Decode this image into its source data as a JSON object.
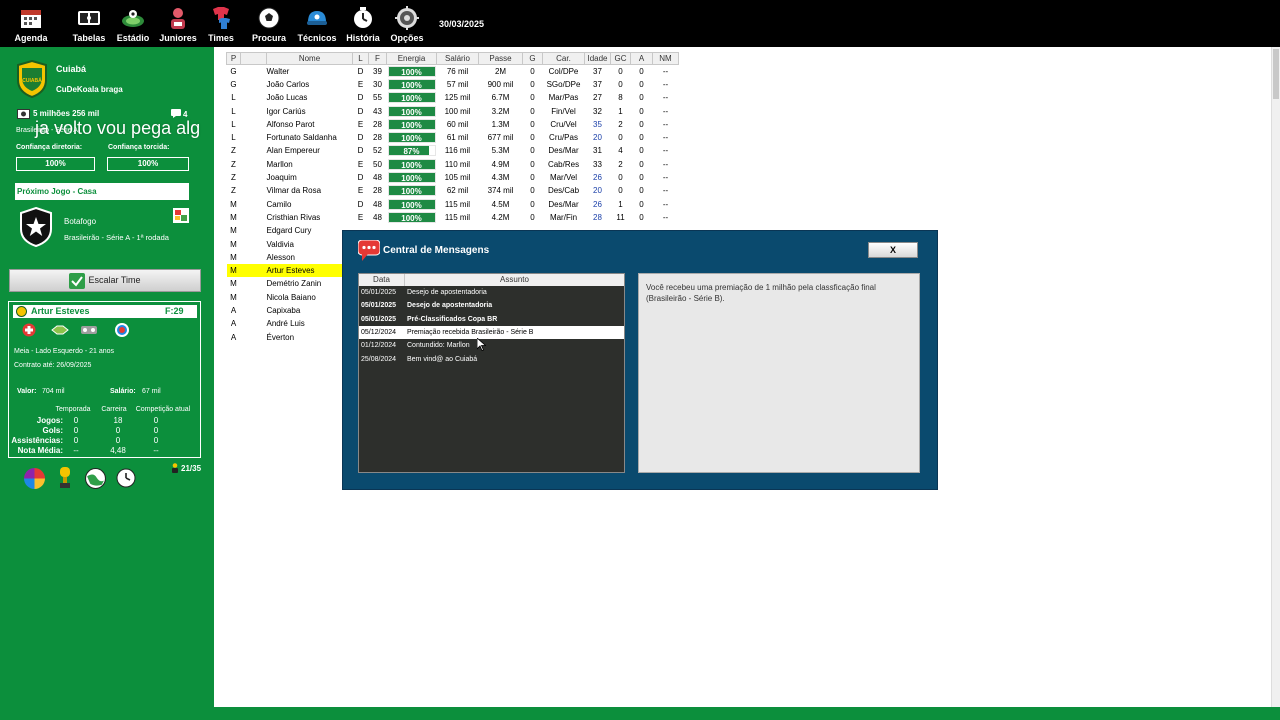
{
  "toolbar": {
    "items": [
      {
        "label": "Agenda",
        "icon": "calendar-icon"
      },
      {
        "label": "Tabelas",
        "icon": "scoreboard-icon"
      },
      {
        "label": "Estádio",
        "icon": "stadium-icon"
      },
      {
        "label": "Juniores",
        "icon": "junior-player-icon"
      },
      {
        "label": "Times",
        "icon": "shirt-icon"
      },
      {
        "label": "Procura",
        "icon": "search-ball-icon"
      },
      {
        "label": "Técnicos",
        "icon": "coach-cap-icon"
      },
      {
        "label": "História",
        "icon": "history-clock-icon"
      },
      {
        "label": "Opções",
        "icon": "options-gear-icon"
      }
    ],
    "date": "30/03/2025"
  },
  "club": {
    "name": "Cuiabá",
    "manager": "CuDeKoala braga",
    "money": "5 milhões 256 mil",
    "messages_count": "4",
    "league_short": "Brasileirão - Série A",
    "board_confidence_label": "Confiança diretoria:",
    "board_confidence": "100%",
    "fans_confidence_label": "Confiança torcida:",
    "fans_confidence": "100%",
    "logo_text": "CUIABÁ"
  },
  "next_game": {
    "header": "Próximo Jogo - Casa",
    "opponent": "Botafogo",
    "competition": "Brasileirão - Série A - 1ª rodada"
  },
  "escalar_label": "Escalar Time",
  "player_card": {
    "name": "Artur Esteves",
    "force": "F:29",
    "position_desc": "Meia - Lado Esquerdo - 21 anos",
    "contract": "Contrato até: 26/09/2025",
    "value_label": "Valor:",
    "value": "704 mil",
    "salary_label": "Salário:",
    "salary": "67 mil",
    "columns": [
      "Temporada",
      "Carreira",
      "Competição atual"
    ],
    "rows": [
      {
        "label": "Jogos:",
        "values": [
          "0",
          "18",
          "0"
        ]
      },
      {
        "label": "Gols:",
        "values": [
          "0",
          "0",
          "0"
        ]
      },
      {
        "label": "Assistências:",
        "values": [
          "0",
          "0",
          "0"
        ]
      },
      {
        "label": "Nota Média:",
        "values": [
          "--",
          "4,48",
          "--"
        ]
      }
    ],
    "squad_count": "21/35"
  },
  "overlay_text": "ja volto vou pega alg",
  "roster": {
    "columns": [
      "P",
      "Nome",
      "L",
      "F",
      "Energia",
      "Salário",
      "Passe",
      "G",
      "Car.",
      "Idade",
      "GC",
      "A",
      "NM"
    ],
    "rows": [
      {
        "p": "G",
        "nome": "Walter",
        "l": "D",
        "f": "39",
        "energia": "100%",
        "energia_value": 1.0,
        "salario": "76 mil",
        "passe": "2M",
        "g": "0",
        "car": "Col/DPe",
        "idade": "37",
        "gc": "0",
        "a": "0",
        "nm": "--"
      },
      {
        "p": "G",
        "nome": "João Carlos",
        "l": "E",
        "f": "30",
        "energia": "100%",
        "energia_value": 1.0,
        "salario": "57 mil",
        "passe": "900 mil",
        "g": "0",
        "car": "SGo/DPe",
        "idade": "37",
        "gc": "0",
        "a": "0",
        "nm": "--"
      },
      {
        "p": "L",
        "nome": "João Lucas",
        "l": "D",
        "f": "55",
        "energia": "100%",
        "energia_value": 1.0,
        "salario": "125 mil",
        "passe": "6.7M",
        "g": "0",
        "car": "Mar/Pas",
        "idade": "27",
        "gc": "8",
        "a": "0",
        "nm": "--"
      },
      {
        "p": "L",
        "nome": "Igor Cariús",
        "l": "D",
        "f": "43",
        "energia": "100%",
        "energia_value": 1.0,
        "salario": "100 mil",
        "passe": "3.2M",
        "g": "0",
        "car": "Fin/Vel",
        "idade": "32",
        "gc": "1",
        "a": "0",
        "nm": "--"
      },
      {
        "p": "L",
        "nome": "Alfonso Parot",
        "l": "E",
        "f": "28",
        "energia": "100%",
        "energia_value": 1.0,
        "salario": "60 mil",
        "passe": "1.3M",
        "g": "0",
        "car": "Cru/Vel",
        "idade": "35",
        "gc": "2",
        "a": "0",
        "nm": "--"
      },
      {
        "p": "L",
        "nome": "Fortunato Saldanha",
        "l": "D",
        "f": "28",
        "energia": "100%",
        "energia_value": 1.0,
        "salario": "61 mil",
        "passe": "677 mil",
        "g": "0",
        "car": "Cru/Pas",
        "idade": "20",
        "gc": "0",
        "a": "0",
        "nm": "--"
      },
      {
        "p": "Z",
        "nome": "Alan Empereur",
        "l": "D",
        "f": "52",
        "energia": "87%",
        "energia_value": 0.87,
        "salario": "116 mil",
        "passe": "5.3M",
        "g": "0",
        "car": "Des/Mar",
        "idade": "31",
        "gc": "4",
        "a": "0",
        "nm": "--"
      },
      {
        "p": "Z",
        "nome": "Marllon",
        "l": "E",
        "f": "50",
        "energia": "100%",
        "energia_value": 1.0,
        "salario": "110 mil",
        "passe": "4.9M",
        "g": "0",
        "car": "Cab/Res",
        "idade": "33",
        "gc": "2",
        "a": "0",
        "nm": "--"
      },
      {
        "p": "Z",
        "nome": "Joaquim",
        "l": "D",
        "f": "48",
        "energia": "100%",
        "energia_value": 1.0,
        "salario": "105 mil",
        "passe": "4.3M",
        "g": "0",
        "car": "Mar/Vel",
        "idade": "26",
        "gc": "0",
        "a": "0",
        "nm": "--"
      },
      {
        "p": "Z",
        "nome": "Vilmar da Rosa",
        "l": "E",
        "f": "28",
        "energia": "100%",
        "energia_value": 1.0,
        "salario": "62 mil",
        "passe": "374 mil",
        "g": "0",
        "car": "Des/Cab",
        "idade": "20",
        "gc": "0",
        "a": "0",
        "nm": "--"
      },
      {
        "p": "M",
        "nome": "Camilo",
        "l": "D",
        "f": "48",
        "energia": "100%",
        "energia_value": 1.0,
        "salario": "115 mil",
        "passe": "4.5M",
        "g": "0",
        "car": "Des/Mar",
        "idade": "26",
        "gc": "1",
        "a": "0",
        "nm": "--"
      },
      {
        "p": "M",
        "nome": "Cristhian Rivas",
        "l": "E",
        "f": "48",
        "energia": "100%",
        "energia_value": 1.0,
        "salario": "115 mil",
        "passe": "4.2M",
        "g": "0",
        "car": "Mar/Fin",
        "idade": "28",
        "gc": "11",
        "a": "0",
        "nm": "--"
      },
      {
        "p": "M",
        "nome": "Edgard Cury",
        "l": "",
        "f": "",
        "energia": "",
        "energia_value": null,
        "salario": "",
        "passe": "",
        "g": "",
        "car": "",
        "idade": "",
        "gc": "",
        "a": "",
        "nm": ""
      },
      {
        "p": "M",
        "nome": "Valdivia",
        "l": "",
        "f": "",
        "energia": "",
        "energia_value": null,
        "salario": "",
        "passe": "",
        "g": "",
        "car": "",
        "idade": "",
        "gc": "",
        "a": "",
        "nm": ""
      },
      {
        "p": "M",
        "nome": "Alesson",
        "l": "",
        "f": "",
        "energia": "",
        "energia_value": null,
        "salario": "",
        "passe": "",
        "g": "",
        "car": "",
        "idade": "",
        "gc": "",
        "a": "",
        "nm": ""
      },
      {
        "p": "M",
        "nome": "Artur Esteves",
        "l": "",
        "f": "",
        "energia": "",
        "energia_value": null,
        "salario": "",
        "passe": "",
        "g": "",
        "car": "",
        "idade": "",
        "gc": "",
        "a": "",
        "nm": "",
        "selected": true
      },
      {
        "p": "M",
        "nome": "Demétrio Zanin",
        "l": "",
        "f": "",
        "energia": "",
        "energia_value": null,
        "salario": "",
        "passe": "",
        "g": "",
        "car": "",
        "idade": "",
        "gc": "",
        "a": "",
        "nm": ""
      },
      {
        "p": "M",
        "nome": "Nicola Baiano",
        "l": "",
        "f": "",
        "energia": "",
        "energia_value": null,
        "salario": "",
        "passe": "",
        "g": "",
        "car": "",
        "idade": "",
        "gc": "",
        "a": "",
        "nm": ""
      },
      {
        "p": "A",
        "nome": "Capixaba",
        "l": "",
        "f": "",
        "energia": "",
        "energia_value": null,
        "salario": "",
        "passe": "",
        "g": "",
        "car": "",
        "idade": "",
        "gc": "",
        "a": "",
        "nm": ""
      },
      {
        "p": "A",
        "nome": "André Luis",
        "l": "",
        "f": "",
        "energia": "",
        "energia_value": null,
        "salario": "",
        "passe": "",
        "g": "",
        "car": "",
        "idade": "",
        "gc": "",
        "a": "",
        "nm": ""
      },
      {
        "p": "A",
        "nome": "Éverton",
        "l": "",
        "f": "",
        "energia": "",
        "energia_value": null,
        "salario": "",
        "passe": "",
        "g": "",
        "car": "",
        "idade": "",
        "gc": "",
        "a": "",
        "nm": ""
      }
    ]
  },
  "messages": {
    "title": "Central de Mensagens",
    "close_label": "X",
    "columns": [
      "Data",
      "Assunto"
    ],
    "items": [
      {
        "date": "05/01/2025",
        "subject": "Desejo de apostentadoria",
        "bold": false,
        "selected": false
      },
      {
        "date": "05/01/2025",
        "subject": "Desejo de apostentadoria",
        "bold": true,
        "selected": false
      },
      {
        "date": "05/01/2025",
        "subject": "Pré-Classificados Copa BR",
        "bold": true,
        "selected": false
      },
      {
        "date": "05/12/2024",
        "subject": "Premiação recebida Brasileirão - Série B",
        "bold": false,
        "selected": true
      },
      {
        "date": "01/12/2024",
        "subject": "Contundido:  Marllon",
        "bold": false,
        "selected": false
      },
      {
        "date": "25/08/2024",
        "subject": "Bem vind@ ao Cuiabá",
        "bold": false,
        "selected": false
      }
    ],
    "body": "Você recebeu uma premiação de 1 milhão pela classficação final (Brasileirão - Série B)."
  },
  "colors": {
    "background_green": "#0c8f3c",
    "energy_green": "#1e8a44",
    "selected_row": "#ffff00",
    "message_panel": "#0a4a6e",
    "message_list": "#2d2f2c"
  }
}
